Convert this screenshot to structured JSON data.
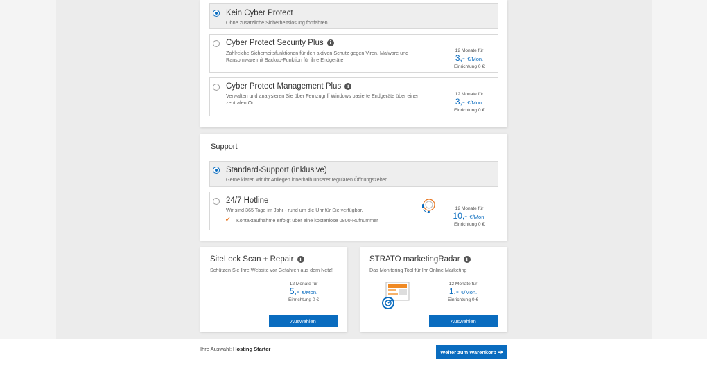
{
  "cyber": {
    "options": [
      {
        "title": "Kein Cyber Protect",
        "desc": "Ohne zusätzliche Sicherheitslösung fortfahren"
      },
      {
        "title": "Cyber Protect Security Plus",
        "desc": "Zahlreiche Sicherheitsfunktionen für den aktiven Schutz gegen Viren, Malware und Ransomware mit Backup-Funktion für ihre Endgeräte",
        "months": "12 Monate für",
        "amount": "3,-",
        "unit": "€/Mon.",
        "setup": "Einrichtung 0 €"
      },
      {
        "title": "Cyber Protect Management Plus",
        "desc": "Verwalten und analysieren Sie über Fernzugriff Windows basierte Endgeräte über einen zentralen Ort",
        "months": "12 Monate für",
        "amount": "3,-",
        "unit": "€/Mon.",
        "setup": "Einrichtung 0 €"
      }
    ]
  },
  "support": {
    "title": "Support",
    "options": [
      {
        "title": "Standard-Support (inklusive)",
        "desc": "Gerne klären wir Ihr Anliegen innerhalb unserer regulären Öffnungszeiten."
      },
      {
        "title": "24/7 Hotline",
        "desc": "Wir sind 365 Tage im Jahr - rund um die Uhr für Sie verfügbar.",
        "feature": "Kontaktaufnahme erfolgt über eine kostenlose 0800-Rufnummer",
        "months": "12 Monate für",
        "amount": "10,-",
        "unit": "€/Mon.",
        "setup": "Einrichtung 0 €"
      }
    ]
  },
  "addons": [
    {
      "title": "SiteLock Scan + Repair",
      "desc": "Schützen Sie Ihre Website vor Gefahren aus dem Netz!",
      "months": "12 Monate für",
      "amount": "5,-",
      "unit": "€/Mon.",
      "setup": "Einrichtung 0 €",
      "button": "Auswählen"
    },
    {
      "title": "STRATO marketingRadar",
      "desc": "Das Monitoring Tool für Ihr Online Marketing",
      "months": "12 Monate für",
      "amount": "1,-",
      "unit": "€/Mon.",
      "setup": "Einrichtung 0 €",
      "button": "Auswählen"
    }
  ],
  "footer": {
    "selection_label": "Ihre Auswahl:",
    "selection_value": "Hosting Starter",
    "cart_button": "Weiter zum Warenkorb"
  },
  "colors": {
    "accent": "#0a6cbf",
    "check": "#e87722"
  }
}
